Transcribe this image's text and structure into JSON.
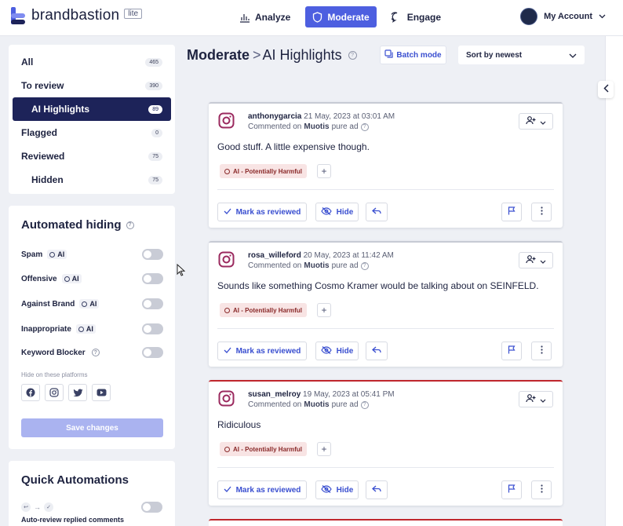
{
  "brand": {
    "name": "brandbastion",
    "badge": "lite"
  },
  "nav": [
    {
      "label": "Analyze",
      "icon": "bar-chart-icon",
      "active": false
    },
    {
      "label": "Moderate",
      "icon": "shield-icon",
      "active": true
    },
    {
      "label": "Engage",
      "icon": "chat-bubble-icon",
      "active": false
    }
  ],
  "account": {
    "label": "My Account"
  },
  "filters": [
    {
      "label": "All",
      "count": "465"
    },
    {
      "label": "To review",
      "count": "390"
    },
    {
      "label": "AI Highlights",
      "count": "89",
      "active": true
    },
    {
      "label": "Flagged",
      "count": "0"
    },
    {
      "label": "Reviewed",
      "count": "75"
    },
    {
      "label": "Hidden",
      "count": "75"
    }
  ],
  "automated_hiding": {
    "title": "Automated hiding",
    "rules": [
      {
        "label": "Spam",
        "ai_badge": "AI",
        "enabled": false
      },
      {
        "label": "Offensive",
        "ai_badge": "AI",
        "enabled": false
      },
      {
        "label": "Against Brand",
        "ai_badge": "AI",
        "enabled": false
      },
      {
        "label": "Inappropriate",
        "ai_badge": "AI",
        "enabled": false
      },
      {
        "label": "Keyword Blocker",
        "enabled": false
      }
    ],
    "platforms_label": "Hide on these platforms",
    "platforms": [
      "facebook-icon",
      "instagram-icon",
      "twitter-icon",
      "youtube-icon"
    ],
    "save_label": "Save changes"
  },
  "quick_automations": {
    "title": "Quick Automations",
    "rule_label": "Auto-review replied comments"
  },
  "header": {
    "crumb": "Moderate",
    "separator": ">",
    "current": "AI Highlights",
    "batch_label": "Batch mode",
    "sort_label": "Sort by newest"
  },
  "comments": [
    {
      "user": "anthonygarcia",
      "date": "21 May, 2023 at 03:01 AM",
      "commented_on_prefix": "Commented on",
      "ad_name": "Muotis",
      "ad_suffix": "pure ad",
      "text": "Good stuff. A little expensive though.",
      "tag": "AI - Potentially Harmful",
      "flagged": false
    },
    {
      "user": "rosa_willeford",
      "date": "20 May, 2023 at 11:42 AM",
      "commented_on_prefix": "Commented on",
      "ad_name": "Muotis",
      "ad_suffix": "pure ad",
      "text": "Sounds like something Cosmo Kramer would be talking about on SEINFELD.",
      "tag": "AI - Potentially Harmful",
      "flagged": false
    },
    {
      "user": "susan_melroy",
      "date": "19 May, 2023 at 05:41 PM",
      "commented_on_prefix": "Commented on",
      "ad_name": "Muotis",
      "ad_suffix": "pure ad",
      "text": "Ridiculous",
      "tag": "AI - Potentially Harmful",
      "flagged": true
    }
  ],
  "actions": {
    "review_label": "Mark as reviewed",
    "hide_label": "Hide"
  },
  "colors": {
    "accent": "#4d5fe0",
    "sidebar_active": "#1d2359",
    "flag_red": "#c0272d",
    "tag_bg": "#f8e4e4"
  }
}
